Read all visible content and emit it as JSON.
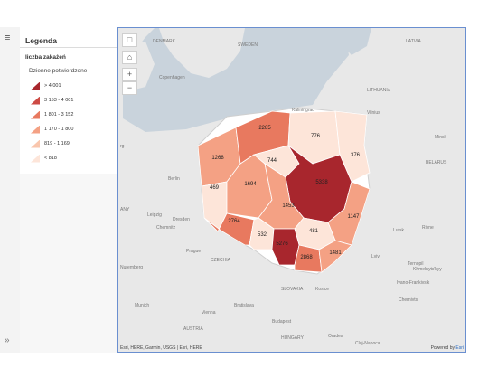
{
  "legend": {
    "title": "Legenda",
    "layer_title": "liczba zakażeń",
    "field_title": "Dzienne potwierdzone",
    "items": [
      {
        "label": "> 4 001",
        "color": "#a8262d"
      },
      {
        "label": "3 153 - 4 001",
        "color": "#cd4a44"
      },
      {
        "label": "1 801 - 3 152",
        "color": "#e8795f"
      },
      {
        "label": "1 170 - 1 800",
        "color": "#f4a184"
      },
      {
        "label": "819 - 1 169",
        "color": "#f9c6ad"
      },
      {
        "label": "< 818",
        "color": "#fde5d9"
      }
    ]
  },
  "map": {
    "attribution": "Esri, HERE, Garmin, USGS | Esri, HERE",
    "powered_by": "Powered by",
    "powered_brand": "Esri",
    "controls": [
      "basemap-icon",
      "home-icon",
      "zoom-in-icon",
      "zoom-out-icon"
    ],
    "labels": {
      "denmark": "DENMARK",
      "sweden": "SWEDEN",
      "latvia": "LATVIA",
      "lithuania": "LITHUANIA",
      "copenhagen": "Copenhagen",
      "kaliningrad": "Kaliningrad",
      "vilnius": "Vilnius",
      "minsk": "Minsk",
      "belarus": "BELARUS",
      "rg": "rg",
      "berlin": "Berlin",
      "any": "ANY",
      "leipzig": "Leipzig",
      "dresden": "Dresden",
      "chemnitz": "Chemnitz",
      "prague": "Prague",
      "czechia": "CZECHIA",
      "nuremberg": "Nuremberg",
      "munich": "Munich",
      "austria": "AUSTRIA",
      "vienna": "Vienna",
      "bratislava": "Bratislava",
      "slovakia": "SLOVAKIA",
      "kosice": "Kosice",
      "budapest": "Budapest",
      "hungary": "HUNGARY",
      "lutsk": "Lutsk",
      "rivne": "Rivne",
      "ternopil": "Ternopil",
      "lviv": "Lviv",
      "khmelnytskyi": "Khmelnyts'kyy",
      "ivano": "Ivano-Frankivs'k",
      "chernivtsi": "Chernivtsi",
      "oradea": "Oradea",
      "cluj": "Cluj-Napoca"
    }
  },
  "regions": [
    {
      "id": "zachodniopomorskie",
      "value": "1268",
      "color": "#f4a184"
    },
    {
      "id": "pomorskie",
      "value": "2285",
      "color": "#e8795f"
    },
    {
      "id": "warminsko-mazurskie",
      "value": "776",
      "color": "#fde5d9"
    },
    {
      "id": "podlaskie",
      "value": "376",
      "color": "#fde5d9"
    },
    {
      "id": "lubuskie",
      "value": "469",
      "color": "#fde5d9"
    },
    {
      "id": "wielkopolskie",
      "value": "1694",
      "color": "#f4a184"
    },
    {
      "id": "kujawsko-pomorskie",
      "value": "744",
      "color": "#fde5d9"
    },
    {
      "id": "mazowieckie",
      "value": "5338",
      "color": "#a8262d"
    },
    {
      "id": "lodzkie",
      "value": "1453",
      "color": "#f4a184"
    },
    {
      "id": "lubelskie",
      "value": "1147",
      "color": "#f4a184"
    },
    {
      "id": "dolnoslaskie",
      "value": "2764",
      "color": "#e8795f"
    },
    {
      "id": "opolskie",
      "value": "532",
      "color": "#fde5d9"
    },
    {
      "id": "swietokrzyskie",
      "value": "481",
      "color": "#fde5d9"
    },
    {
      "id": "slaskie",
      "value": "5276",
      "color": "#a8262d"
    },
    {
      "id": "malopolskie",
      "value": "2868",
      "color": "#e8795f"
    },
    {
      "id": "podkarpackie",
      "value": "1481",
      "color": "#f4a184"
    }
  ]
}
